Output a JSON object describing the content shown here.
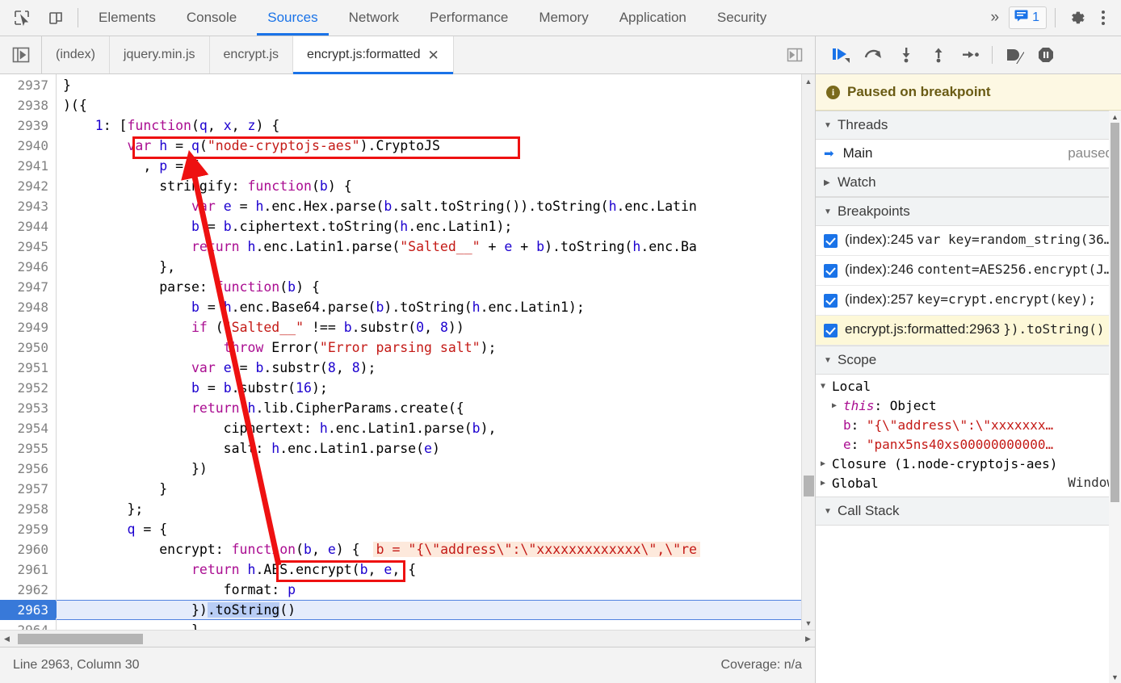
{
  "toolbar": {
    "icons": [
      {
        "name": "inspect-element-icon",
        "glyph": "inspect"
      },
      {
        "name": "device-toolbar-icon",
        "glyph": "device"
      }
    ],
    "panels": [
      {
        "label": "Elements",
        "active": false
      },
      {
        "label": "Console",
        "active": false
      },
      {
        "label": "Sources",
        "active": true
      },
      {
        "label": "Network",
        "active": false
      },
      {
        "label": "Performance",
        "active": false
      },
      {
        "label": "Memory",
        "active": false
      },
      {
        "label": "Application",
        "active": false
      },
      {
        "label": "Security",
        "active": false
      }
    ],
    "more_label": "»",
    "message_count": "1",
    "accent_color": "#1a73e8"
  },
  "file_tabs": {
    "items": [
      {
        "label": "(index)",
        "active": false,
        "closable": false
      },
      {
        "label": "jquery.min.js",
        "active": false,
        "closable": false
      },
      {
        "label": "encrypt.js",
        "active": false,
        "closable": false
      },
      {
        "label": "encrypt.js:formatted",
        "active": true,
        "closable": true,
        "close_label": "✕"
      }
    ]
  },
  "editor": {
    "first_line": 2937,
    "current_line": 2963,
    "lines": [
      {
        "n": "2937",
        "text": "}"
      },
      {
        "n": "2938",
        "text": ")({"
      },
      {
        "n": "2939",
        "text": "    1: [function(q, x, z) {"
      },
      {
        "n": "2940",
        "text": "        var h = q(\"node-cryptojs-aes\").CryptoJS"
      },
      {
        "n": "2941",
        "text": "          , p = {"
      },
      {
        "n": "2942",
        "text": "            stringify: function(b) {"
      },
      {
        "n": "2943",
        "text": "                var e = h.enc.Hex.parse(b.salt.toString()).toString(h.enc.Latin"
      },
      {
        "n": "2944",
        "text": "                b = b.ciphertext.toString(h.enc.Latin1);"
      },
      {
        "n": "2945",
        "text": "                return h.enc.Latin1.parse(\"Salted__\" + e + b).toString(h.enc.Ba"
      },
      {
        "n": "2946",
        "text": "            },"
      },
      {
        "n": "2947",
        "text": "            parse: function(b) {"
      },
      {
        "n": "2948",
        "text": "                b = h.enc.Base64.parse(b).toString(h.enc.Latin1);"
      },
      {
        "n": "2949",
        "text": "                if (\"Salted__\" !== b.substr(0, 8))"
      },
      {
        "n": "2950",
        "text": "                    throw Error(\"Error parsing salt\");"
      },
      {
        "n": "2951",
        "text": "                var e = b.substr(8, 8);"
      },
      {
        "n": "2952",
        "text": "                b = b.substr(16);"
      },
      {
        "n": "2953",
        "text": "                return h.lib.CipherParams.create({"
      },
      {
        "n": "2954",
        "text": "                    ciphertext: h.enc.Latin1.parse(b),"
      },
      {
        "n": "2955",
        "text": "                    salt: h.enc.Latin1.parse(e)"
      },
      {
        "n": "2956",
        "text": "                })"
      },
      {
        "n": "2957",
        "text": "            }"
      },
      {
        "n": "2958",
        "text": "        };"
      },
      {
        "n": "2959",
        "text": "        q = {"
      },
      {
        "n": "2960",
        "text": "            encrypt: function(b, e) {"
      },
      {
        "n": "2961",
        "text": "                return h.AES.encrypt(b, e, {"
      },
      {
        "n": "2962",
        "text": "                    format: p"
      },
      {
        "n": "2963",
        "text": "                }).toString()"
      },
      {
        "n": "2964",
        "text": "                }"
      }
    ],
    "inline_value_line": "2960",
    "inline_value_text": "b = \"{\\\"address\\\":\\\"xxxxxxxxxxxxx\\\",\\\"re",
    "selection_line": "2963",
    "selection_text": ".toString"
  },
  "annotations": {
    "boxes": [
      {
        "name": "highlight-var-h-line",
        "label": "var h = q(\"node-cryptojs-aes\").CryptoJS"
      },
      {
        "name": "highlight-aes-encrypt",
        "label": "h.AES.encrypt"
      }
    ],
    "arrow": {
      "name": "annotation-arrow",
      "color": "#ee1111"
    },
    "color": "#ee1111"
  },
  "status_bar": {
    "cursor": "Line 2963, Column 30",
    "coverage": "Coverage: n/a"
  },
  "debugger": {
    "controls": [
      {
        "name": "resume-script-execution-button",
        "title": "Resume"
      },
      {
        "name": "step-over-next-function-call-button",
        "title": "Step over"
      },
      {
        "name": "step-into-next-function-call-button",
        "title": "Step into"
      },
      {
        "name": "step-out-of-current-function-button",
        "title": "Step out"
      },
      {
        "name": "step-button",
        "title": "Step"
      },
      {
        "name": "deactivate-breakpoints-button",
        "title": "Deactivate breakpoints"
      },
      {
        "name": "pause-on-exceptions-button",
        "title": "Pause on exceptions"
      }
    ],
    "pause_banner": "Paused on breakpoint",
    "sections": {
      "threads": {
        "title": "Threads",
        "expanded": true,
        "rows": [
          {
            "name": "Main",
            "state": "paused"
          }
        ]
      },
      "watch": {
        "title": "Watch",
        "expanded": false
      },
      "breakpoints": {
        "title": "Breakpoints",
        "expanded": true,
        "items": [
          {
            "location": "(index):245",
            "code": "var key=random_string(36…",
            "checked": true,
            "selected": false
          },
          {
            "location": "(index):246",
            "code": "content=AES256.encrypt(J…",
            "checked": true,
            "selected": false
          },
          {
            "location": "(index):257",
            "code": "key=crypt.encrypt(key);",
            "checked": true,
            "selected": false
          },
          {
            "location": "encrypt.js:formatted:2963",
            "code": "}).toString()",
            "checked": true,
            "selected": true
          }
        ]
      },
      "scope": {
        "title": "Scope",
        "expanded": true,
        "rows": [
          {
            "kind": "group",
            "expanded": true,
            "name": "Local",
            "value": ""
          },
          {
            "kind": "prop",
            "expandable": true,
            "name": "this",
            "italic": true,
            "value": "Object",
            "value_type": "obj"
          },
          {
            "kind": "prop",
            "expandable": false,
            "name": "b",
            "italic": false,
            "value": "\"{\\\"address\\\":\\\"xxxxxxx…",
            "value_type": "str"
          },
          {
            "kind": "prop",
            "expandable": false,
            "name": "e",
            "italic": false,
            "value": "\"panx5ns40xs00000000000…",
            "value_type": "str"
          },
          {
            "kind": "group",
            "expanded": false,
            "name": "Closure (1.node-cryptojs-aes)",
            "value": ""
          },
          {
            "kind": "group",
            "expanded": false,
            "name": "Global",
            "value": "Window"
          }
        ]
      },
      "call_stack": {
        "title": "Call Stack",
        "expanded": true
      }
    }
  }
}
